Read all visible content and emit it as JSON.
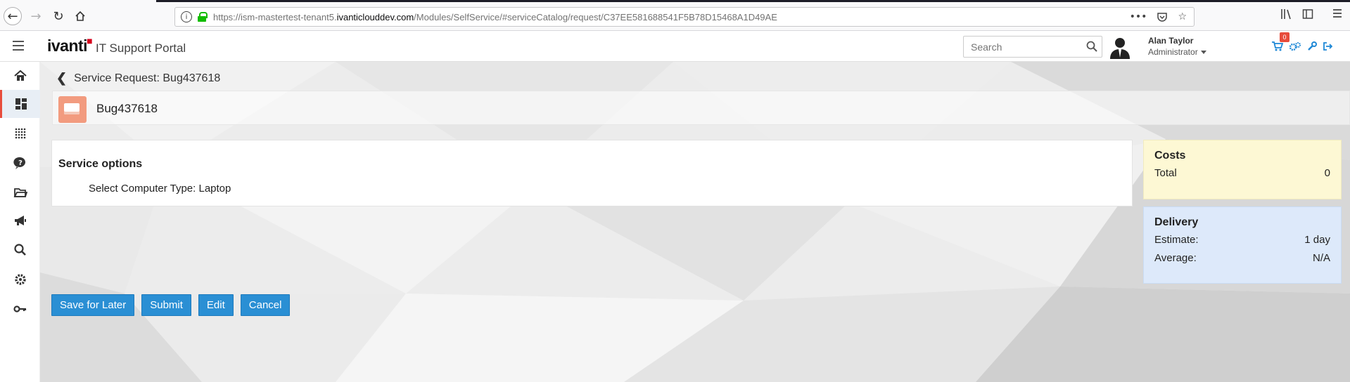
{
  "browser": {
    "url_prefix": "https://ism-mastertest-tenant5.",
    "url_domain": "ivanticlouddev.com",
    "url_suffix": "/Modules/SelfService/#serviceCatalog/request/C37EE581688541F5B78D15468A1D49AE",
    "more_icon": "•••"
  },
  "header": {
    "logo_text": "ivanti",
    "portal_title": "IT Support Portal",
    "search_placeholder": "Search",
    "user_name": "Alan Taylor",
    "user_role": "Administrator",
    "cart_count": "0"
  },
  "sidebar": {
    "items": [
      {
        "icon": "home-icon"
      },
      {
        "icon": "dashboard-icon",
        "active": true
      },
      {
        "icon": "service-catalog-icon"
      },
      {
        "icon": "help-icon"
      },
      {
        "icon": "folder-icon"
      },
      {
        "icon": "announcement-icon"
      },
      {
        "icon": "search-icon"
      },
      {
        "icon": "settings-icon"
      },
      {
        "icon": "key-icon"
      }
    ]
  },
  "page": {
    "breadcrumb": "Service Request: Bug437618",
    "title": "Bug437618",
    "service_options": {
      "heading": "Service options",
      "row_label": "Select Computer Type:",
      "row_value": "Laptop"
    },
    "costs": {
      "heading": "Costs",
      "total_label": "Total",
      "total_value": "0"
    },
    "delivery": {
      "heading": "Delivery",
      "estimate_label": "Estimate:",
      "estimate_value": "1 day",
      "average_label": "Average:",
      "average_value": "N/A"
    },
    "buttons": {
      "save_for_later": "Save for Later",
      "submit": "Submit",
      "edit": "Edit",
      "cancel": "Cancel"
    }
  },
  "colors": {
    "accent": "#2a8fd4",
    "costs_bg": "#fdf8d4",
    "delivery_bg": "#dde9fa",
    "sidebar_active_marker": "#e74c3c"
  }
}
